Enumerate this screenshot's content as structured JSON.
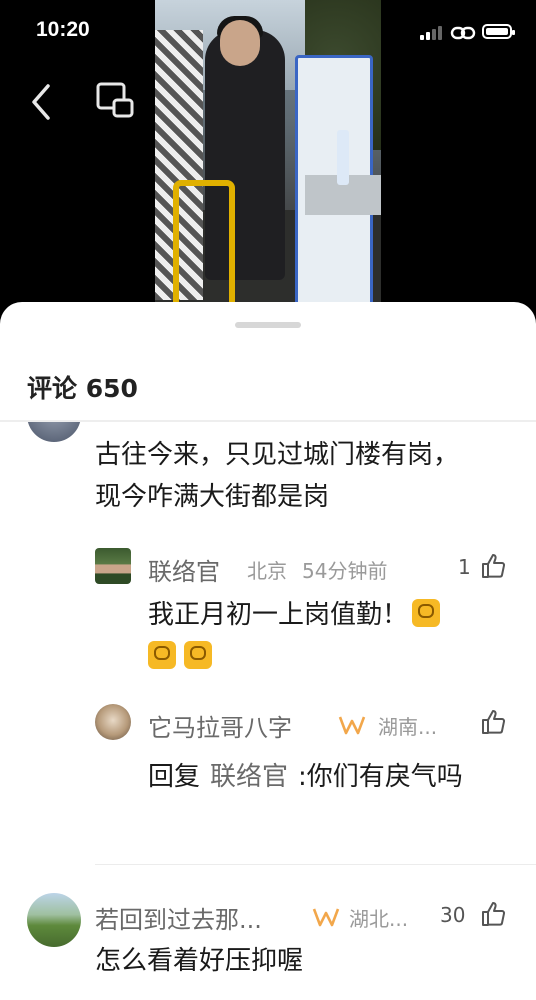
{
  "status_bar": {
    "time": "10:20"
  },
  "comments_panel": {
    "title": "评论 650",
    "comments": [
      {
        "text": "古往今来，只见过城门楼有岗，现今咋满大街都是岗"
      },
      {
        "name": "联络官",
        "location": "北京",
        "time_ago": "54分钟前",
        "likes": "1",
        "text": "我正月初一上岗值勤！"
      },
      {
        "name": "它马拉哥八字",
        "location": "湖南...",
        "reply_prefix": "回复",
        "reply_to": "联络官",
        "text": ":你们有戾气吗"
      },
      {
        "name": "若回到过去那...",
        "location": "湖北...",
        "likes": "30",
        "text": "怎么看着好压抑喔"
      }
    ]
  }
}
